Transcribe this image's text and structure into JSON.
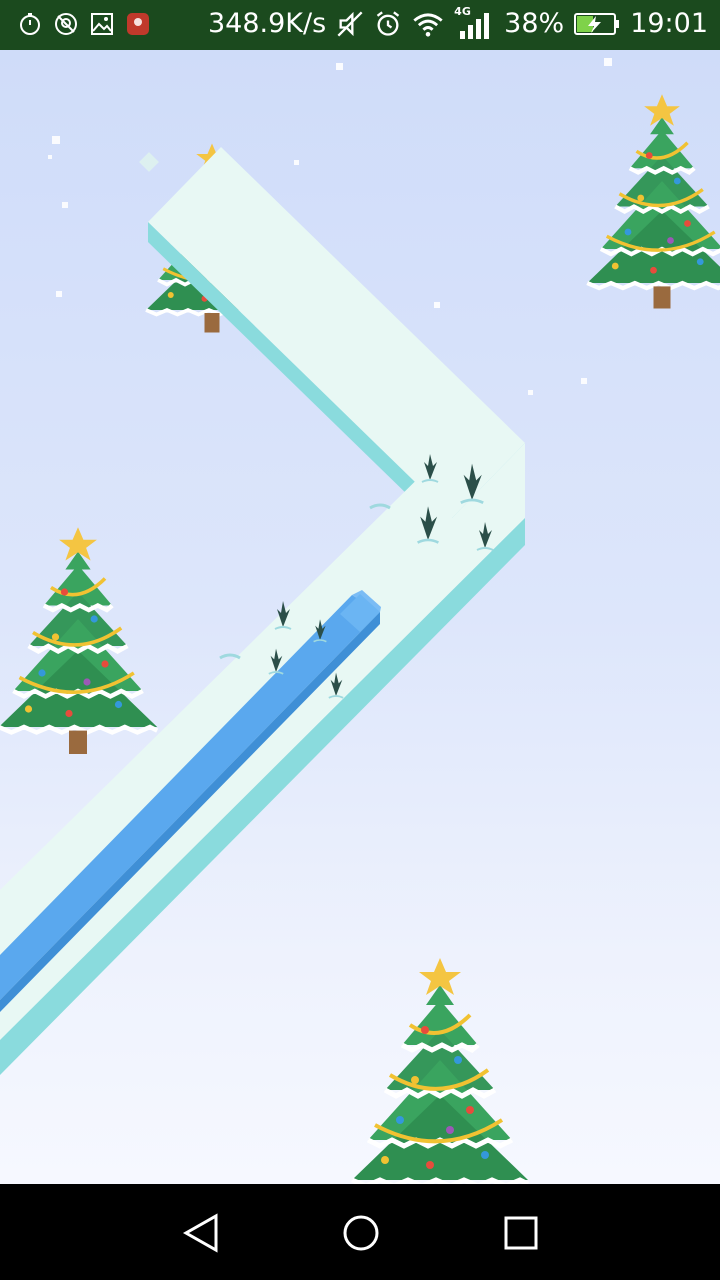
{
  "status_bar": {
    "net_speed": "348.9K/s",
    "network_type": "4G",
    "battery": "38%",
    "time": "19:01",
    "left_icons": [
      "stopwatch-icon",
      "no-location-icon",
      "gallery-icon",
      "huawei-app-icon"
    ],
    "right_icons": [
      "mute-icon",
      "alarm-icon",
      "wifi-icon",
      "signal-icon",
      "battery-charging-icon"
    ]
  },
  "game": {
    "scene": "winter-zigzag",
    "colors": {
      "sky_top": "#cfdcf9",
      "sky_bottom": "#f6f8ff",
      "path_top": "#e8f8f4",
      "path_side": "#8adbdd",
      "snake": "#5aa8ee",
      "tree_green": "#3aa45f",
      "garland": "#f1c232",
      "star": "#f4c542"
    }
  },
  "nav_bar": {
    "buttons": [
      "back-icon",
      "home-icon",
      "recents-icon"
    ]
  }
}
